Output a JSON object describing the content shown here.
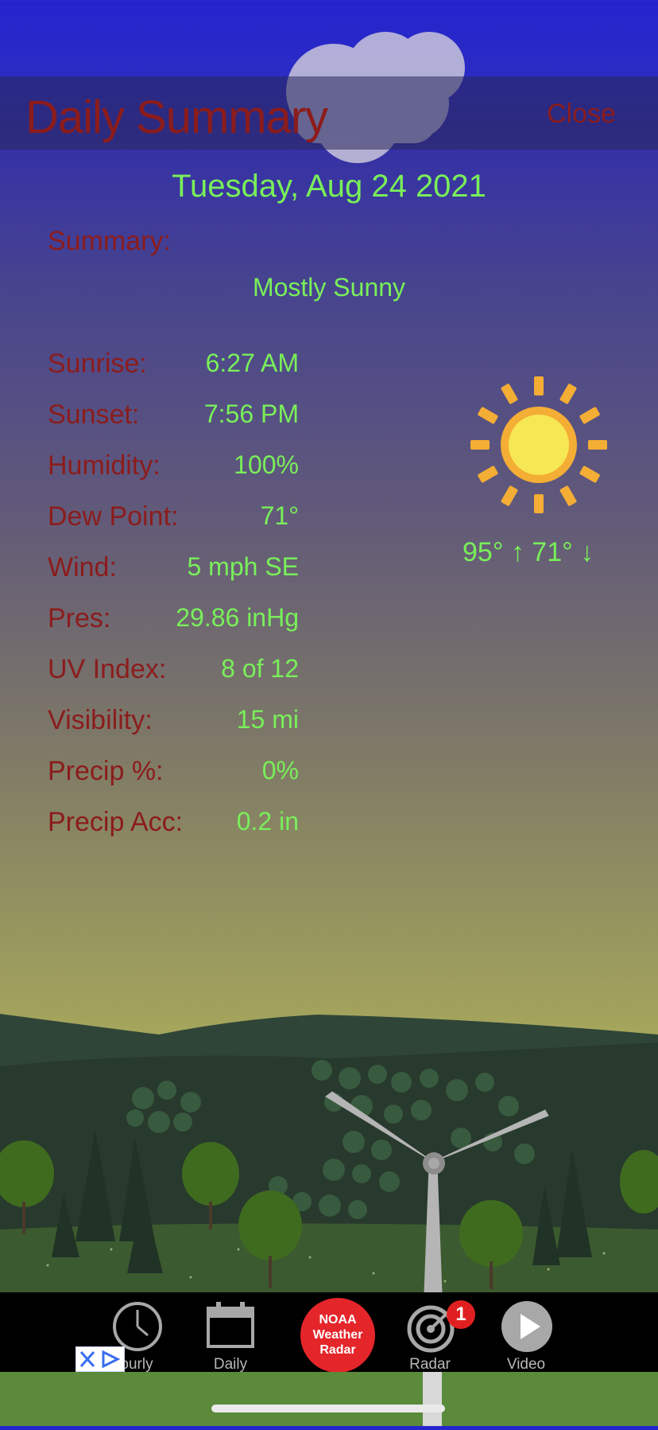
{
  "header": {
    "title": "Daily Summary",
    "close_label": "Close"
  },
  "date": "Tuesday, Aug 24 2021",
  "summary": {
    "label": "Summary:",
    "value": "Mostly Sunny"
  },
  "details": [
    {
      "label": "Sunrise:",
      "value": "6:27 AM"
    },
    {
      "label": "Sunset:",
      "value": "7:56 PM"
    },
    {
      "label": "Humidity:",
      "value": "100%"
    },
    {
      "label": "Dew Point:",
      "value": "71°"
    },
    {
      "label": "Wind:",
      "value": "5 mph SE"
    },
    {
      "label": "Pres:",
      "value": "29.86 inHg"
    },
    {
      "label": "UV Index:",
      "value": "8 of 12"
    },
    {
      "label": "Visibility:",
      "value": "15 mi"
    },
    {
      "label": "Precip %:",
      "value": "0%"
    },
    {
      "label": "Precip Acc:",
      "value": "0.2 in"
    }
  ],
  "forecast": {
    "icon": "sun-icon",
    "temps": "95° ↑ 71° ↓"
  },
  "tabbar": {
    "hourly_label": "ourly",
    "daily_label": "Daily",
    "noaa_line1": "NOAA",
    "noaa_line2": "Weather",
    "noaa_line3": "Radar",
    "radar_label": "Radar",
    "radar_badge": "1",
    "video_label": "Video"
  },
  "colors": {
    "label_red": "#8b1c1c",
    "value_green": "#79ef5a",
    "accent_red": "#e4262b"
  }
}
